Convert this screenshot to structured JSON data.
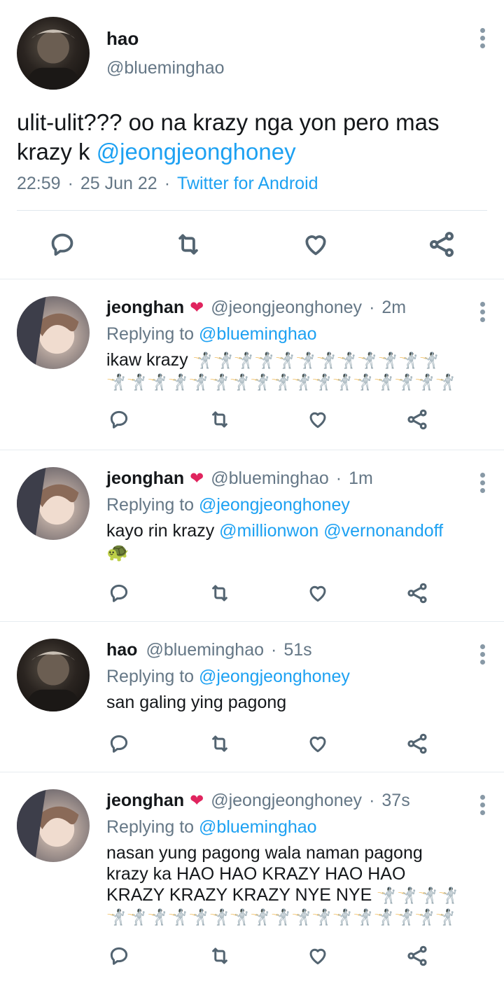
{
  "main_tweet": {
    "name": "hao",
    "handle": "@blueminghao",
    "text": "ulit-ulit??? oo na krazy nga yon pero mas krazy k",
    "mention": "@jeongjeonghoney",
    "time": "22:59",
    "date": "25 Jun 22",
    "source": "Twitter for Android",
    "separator": "·"
  },
  "replies": [
    {
      "name": "jeonghan",
      "heart": "❤",
      "handle": "@jeongjeonghoney",
      "time": "2m",
      "replying_label": "Replying to",
      "replying_to": "@blueminghao",
      "text": "ikaw krazy",
      "emoji_line1": "🤺🤺🤺🤺🤺🤺🤺🤺🤺🤺🤺🤺",
      "emoji_line2": "🤺🤺🤺🤺🤺🤺🤺🤺🤺🤺🤺🤺🤺🤺🤺🤺🤺"
    },
    {
      "name": "jeonghan",
      "heart": "❤",
      "handle": "@blueminghao",
      "time": "1m",
      "replying_label": "Replying to",
      "replying_to": "@jeongjeonghoney",
      "text": "kayo rin krazy",
      "mention1": "@millionwon",
      "mention2": "@vernonandoff",
      "emoji": "🐢"
    },
    {
      "name": "hao",
      "handle": "@blueminghao",
      "time": "51s",
      "replying_label": "Replying to",
      "replying_to": "@jeongjeonghoney",
      "text": "san galing ying pagong"
    },
    {
      "name": "jeonghan",
      "heart": "❤",
      "handle": "@jeongjeonghoney",
      "time": "37s",
      "replying_label": "Replying to",
      "replying_to": "@blueminghao",
      "line1": "nasan yung pagong wala naman pagong",
      "line2": "krazy ka HAO HAO KRAZY HAO HAO",
      "line3": "KRAZY KRAZY KRAZY NYE NYE",
      "emoji_line3": "🤺🤺🤺🤺",
      "emoji_line4": "🤺🤺🤺🤺🤺🤺🤺🤺🤺🤺🤺🤺🤺🤺🤺🤺🤺"
    }
  ],
  "icons": {
    "reply": "reply-icon",
    "retweet": "retweet-icon",
    "like": "like-icon",
    "share": "share-icon",
    "more": "more-vertical-icon"
  },
  "colors": {
    "link": "#1da1f2",
    "secondary": "#657786",
    "heart": "#e0245e",
    "icon": "#536471"
  }
}
